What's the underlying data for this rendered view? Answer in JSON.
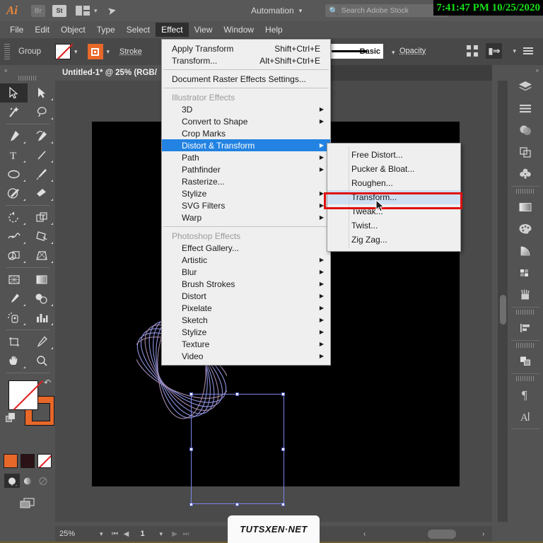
{
  "app": {
    "logo": "Ai",
    "bridge_badge": "Br",
    "stock_badge": "St",
    "arrange_icon": "arrange-documents-icon",
    "rocket_icon": "rocket-icon",
    "automation_label": "Automation",
    "search_placeholder": "Search Adobe Stock",
    "clock": "7:41:47 PM 10/25/2020"
  },
  "menubar": {
    "items": [
      {
        "label": "File",
        "active": false
      },
      {
        "label": "Edit",
        "active": false
      },
      {
        "label": "Object",
        "active": false
      },
      {
        "label": "Type",
        "active": false
      },
      {
        "label": "Select",
        "active": false
      },
      {
        "label": "Effect",
        "active": true
      },
      {
        "label": "View",
        "active": false
      },
      {
        "label": "Window",
        "active": false
      },
      {
        "label": "Help",
        "active": false
      }
    ]
  },
  "controlbar": {
    "selection_type": "Group",
    "fill_swatch": "none-fill-swatch",
    "stroke_swatch": "orange-stroke-swatch",
    "stroke_label": "Stroke",
    "brush_profile": "Basic",
    "opacity_label": "Opacity",
    "align_icon": "align-icon",
    "transform_icon": "transform-icon",
    "options_icon": "options-menu-icon"
  },
  "document": {
    "tab_title": "Untitled-1* @ 25% (RGB/",
    "zoom": "25%",
    "page": "1",
    "artboard_color": "#000000"
  },
  "effect_menu": {
    "groups": [
      {
        "items": [
          {
            "label": "Apply Transform",
            "shortcut": "Shift+Ctrl+E",
            "arrow": false,
            "indent": false,
            "header": false,
            "highlight": false
          },
          {
            "label": "Transform...",
            "shortcut": "Alt+Shift+Ctrl+E",
            "arrow": false,
            "indent": false,
            "header": false,
            "highlight": false
          }
        ]
      },
      {
        "items": [
          {
            "label": "Document Raster Effects Settings...",
            "shortcut": "",
            "arrow": false,
            "indent": false,
            "header": false,
            "highlight": false
          }
        ]
      },
      {
        "items": [
          {
            "label": "Illustrator Effects",
            "shortcut": "",
            "arrow": false,
            "indent": false,
            "header": true,
            "highlight": false
          },
          {
            "label": "3D",
            "shortcut": "",
            "arrow": true,
            "indent": true,
            "header": false,
            "highlight": false
          },
          {
            "label": "Convert to Shape",
            "shortcut": "",
            "arrow": true,
            "indent": true,
            "header": false,
            "highlight": false
          },
          {
            "label": "Crop Marks",
            "shortcut": "",
            "arrow": false,
            "indent": true,
            "header": false,
            "highlight": false
          },
          {
            "label": "Distort & Transform",
            "shortcut": "",
            "arrow": true,
            "indent": true,
            "header": false,
            "highlight": true
          },
          {
            "label": "Path",
            "shortcut": "",
            "arrow": true,
            "indent": true,
            "header": false,
            "highlight": false
          },
          {
            "label": "Pathfinder",
            "shortcut": "",
            "arrow": true,
            "indent": true,
            "header": false,
            "highlight": false
          },
          {
            "label": "Rasterize...",
            "shortcut": "",
            "arrow": false,
            "indent": true,
            "header": false,
            "highlight": false
          },
          {
            "label": "Stylize",
            "shortcut": "",
            "arrow": true,
            "indent": true,
            "header": false,
            "highlight": false
          },
          {
            "label": "SVG Filters",
            "shortcut": "",
            "arrow": true,
            "indent": true,
            "header": false,
            "highlight": false
          },
          {
            "label": "Warp",
            "shortcut": "",
            "arrow": true,
            "indent": true,
            "header": false,
            "highlight": false
          }
        ]
      },
      {
        "items": [
          {
            "label": "Photoshop Effects",
            "shortcut": "",
            "arrow": false,
            "indent": false,
            "header": true,
            "highlight": false
          },
          {
            "label": "Effect Gallery...",
            "shortcut": "",
            "arrow": false,
            "indent": true,
            "header": false,
            "highlight": false
          },
          {
            "label": "Artistic",
            "shortcut": "",
            "arrow": true,
            "indent": true,
            "header": false,
            "highlight": false
          },
          {
            "label": "Blur",
            "shortcut": "",
            "arrow": true,
            "indent": true,
            "header": false,
            "highlight": false
          },
          {
            "label": "Brush Strokes",
            "shortcut": "",
            "arrow": true,
            "indent": true,
            "header": false,
            "highlight": false
          },
          {
            "label": "Distort",
            "shortcut": "",
            "arrow": true,
            "indent": true,
            "header": false,
            "highlight": false
          },
          {
            "label": "Pixelate",
            "shortcut": "",
            "arrow": true,
            "indent": true,
            "header": false,
            "highlight": false
          },
          {
            "label": "Sketch",
            "shortcut": "",
            "arrow": true,
            "indent": true,
            "header": false,
            "highlight": false
          },
          {
            "label": "Stylize",
            "shortcut": "",
            "arrow": true,
            "indent": true,
            "header": false,
            "highlight": false
          },
          {
            "label": "Texture",
            "shortcut": "",
            "arrow": true,
            "indent": true,
            "header": false,
            "highlight": false
          },
          {
            "label": "Video",
            "shortcut": "",
            "arrow": true,
            "indent": true,
            "header": false,
            "highlight": false
          }
        ]
      }
    ]
  },
  "submenu": {
    "title": "Distort & Transform",
    "items": [
      {
        "label": "Free Distort...",
        "selected": false
      },
      {
        "label": "Pucker & Bloat...",
        "selected": false
      },
      {
        "label": "Roughen...",
        "selected": false
      },
      {
        "label": "Transform...",
        "selected": true
      },
      {
        "label": "Tweak...",
        "selected": false
      },
      {
        "label": "Twist...",
        "selected": false
      },
      {
        "label": "Zig Zag...",
        "selected": false
      }
    ],
    "highlight_color": "#e01010"
  },
  "left_toolbar": {
    "tools": [
      "selection-tool",
      "direct-selection-tool",
      "magic-wand-tool",
      "lasso-tool",
      "pen-tool",
      "curvature-tool",
      "type-tool",
      "line-segment-tool",
      "ellipse-tool",
      "paintbrush-tool",
      "shaper-tool",
      "eraser-tool",
      "rotate-tool",
      "scale-tool",
      "width-tool",
      "free-transform-tool",
      "shape-builder-tool",
      "perspective-grid-tool",
      "mesh-tool",
      "gradient-tool",
      "eyedropper-tool",
      "blend-tool",
      "symbol-sprayer-tool",
      "column-graph-tool",
      "artboard-tool",
      "slice-tool",
      "hand-tool",
      "zoom-tool"
    ],
    "fill_color": "#ffffff",
    "stroke_color": "#e8682a",
    "swatch_row": [
      "#e8682a",
      "#2b1216",
      "none"
    ],
    "gradient_modes": [
      "color-mode",
      "gradient-mode",
      "none-mode"
    ],
    "screen_mode_icon": "screen-mode-icon"
  },
  "right_panel": {
    "items": [
      "layers-icon",
      "properties-icon",
      "transparency-icon",
      "pathfinder-icon",
      "symbols-icon",
      "gradient-icon",
      "color-icon",
      "color-guide-icon",
      "swatches-icon",
      "brushes-icon",
      "align-icon",
      "transform-panel-icon",
      "paragraph-icon",
      "character-icon"
    ]
  },
  "statusbar": {
    "zoom": "25%",
    "first_page_icon": "first-page-icon",
    "prev_page_icon": "prev-page-icon",
    "page": "1",
    "next_page_icon": "next-page-icon",
    "last_page_icon": "last-page-icon"
  },
  "watermark": {
    "text": "TUTSXEN·NET"
  },
  "artwork": {
    "description": "rotated-ellipse-arcs",
    "stroke_color": "#8f93e0",
    "accent_color": "#c97a5e",
    "selection_color": "#7b86e8"
  }
}
